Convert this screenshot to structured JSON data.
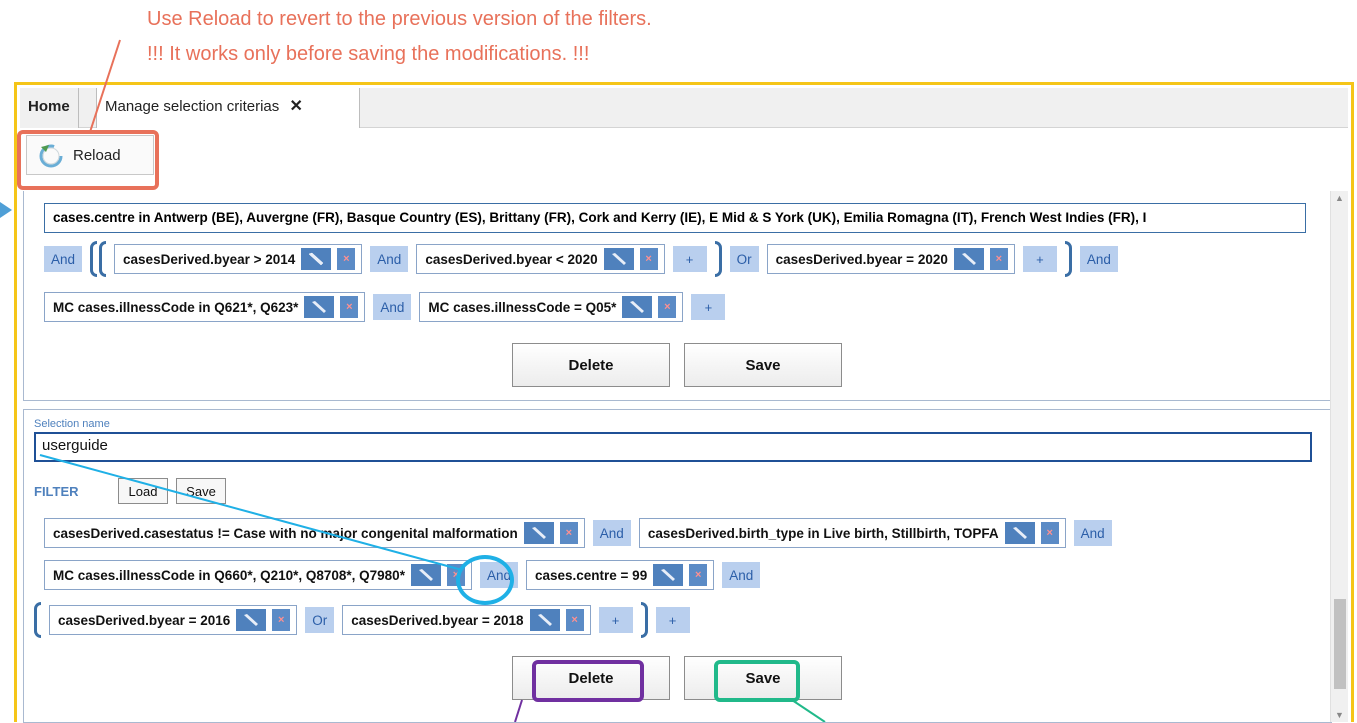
{
  "annotation": {
    "line1": "Use Reload to revert to the previous version of the filters.",
    "line2": "!!! It works only before saving the modifications. !!!"
  },
  "colors": {
    "frame": "#f5c518",
    "annotation_orange": "#e8715a",
    "callout_purple": "#7030a0",
    "callout_green": "#21b98a",
    "callout_blue": "#1fb0e6",
    "accent_blue": "#4f81bd"
  },
  "tabs": {
    "home": "Home",
    "manage": "Manage selection criterias",
    "close": "✕"
  },
  "toolbar": {
    "reload_label": "Reload",
    "reload_icon": "reload-icon"
  },
  "panel1": {
    "filter1": "cases.centre in Antwerp (BE), Auvergne (FR), Basque Country (ES), Brittany (FR), Cork and Kerry (IE), E Mid & S York (UK), Emilia Romagna (IT), French West Indies (FR), I",
    "op_and_1": "And",
    "chip_byear_gt": "casesDerived.byear > 2014",
    "op_and_2": "And",
    "chip_byear_lt": "casesDerived.byear < 2020",
    "plus_1": "+",
    "op_or_1": "Or",
    "chip_byear_eq": "casesDerived.byear = 2020",
    "plus_2": "+",
    "op_and_3": "And",
    "chip_illness_q62": "MC cases.illnessCode in Q621*, Q623*",
    "op_and_4": "And",
    "chip_illness_q05": "MC cases.illnessCode = Q05*",
    "plus_3": "+",
    "delete_label": "Delete",
    "save_label": "Save"
  },
  "panel2": {
    "selection_label": "Selection name",
    "selection_value": "userguide",
    "filter_label": "FILTER",
    "load_label": "Load",
    "save_small_label": "Save",
    "chip_casestatus": "casesDerived.casestatus != Case with no major congenital malformation",
    "op_and_1": "And",
    "chip_birthtype": "casesDerived.birth_type in Live birth, Stillbirth, TOPFA",
    "op_and_2": "And",
    "chip_illness_q66": "MC cases.illnessCode in Q660*, Q210*, Q8708*, Q7980*",
    "op_and_3": "And",
    "chip_centre": "cases.centre = 99",
    "op_and_4": "And",
    "chip_byear_2016": "casesDerived.byear = 2016",
    "op_or": "Or",
    "chip_byear_2018": "casesDerived.byear = 2018",
    "plus_1": "+",
    "plus_2": "+",
    "delete_label": "Delete",
    "save_label": "Save"
  },
  "glyphs": {
    "delete_x": "×",
    "scroll_up": "▲",
    "scroll_down": "▼"
  }
}
